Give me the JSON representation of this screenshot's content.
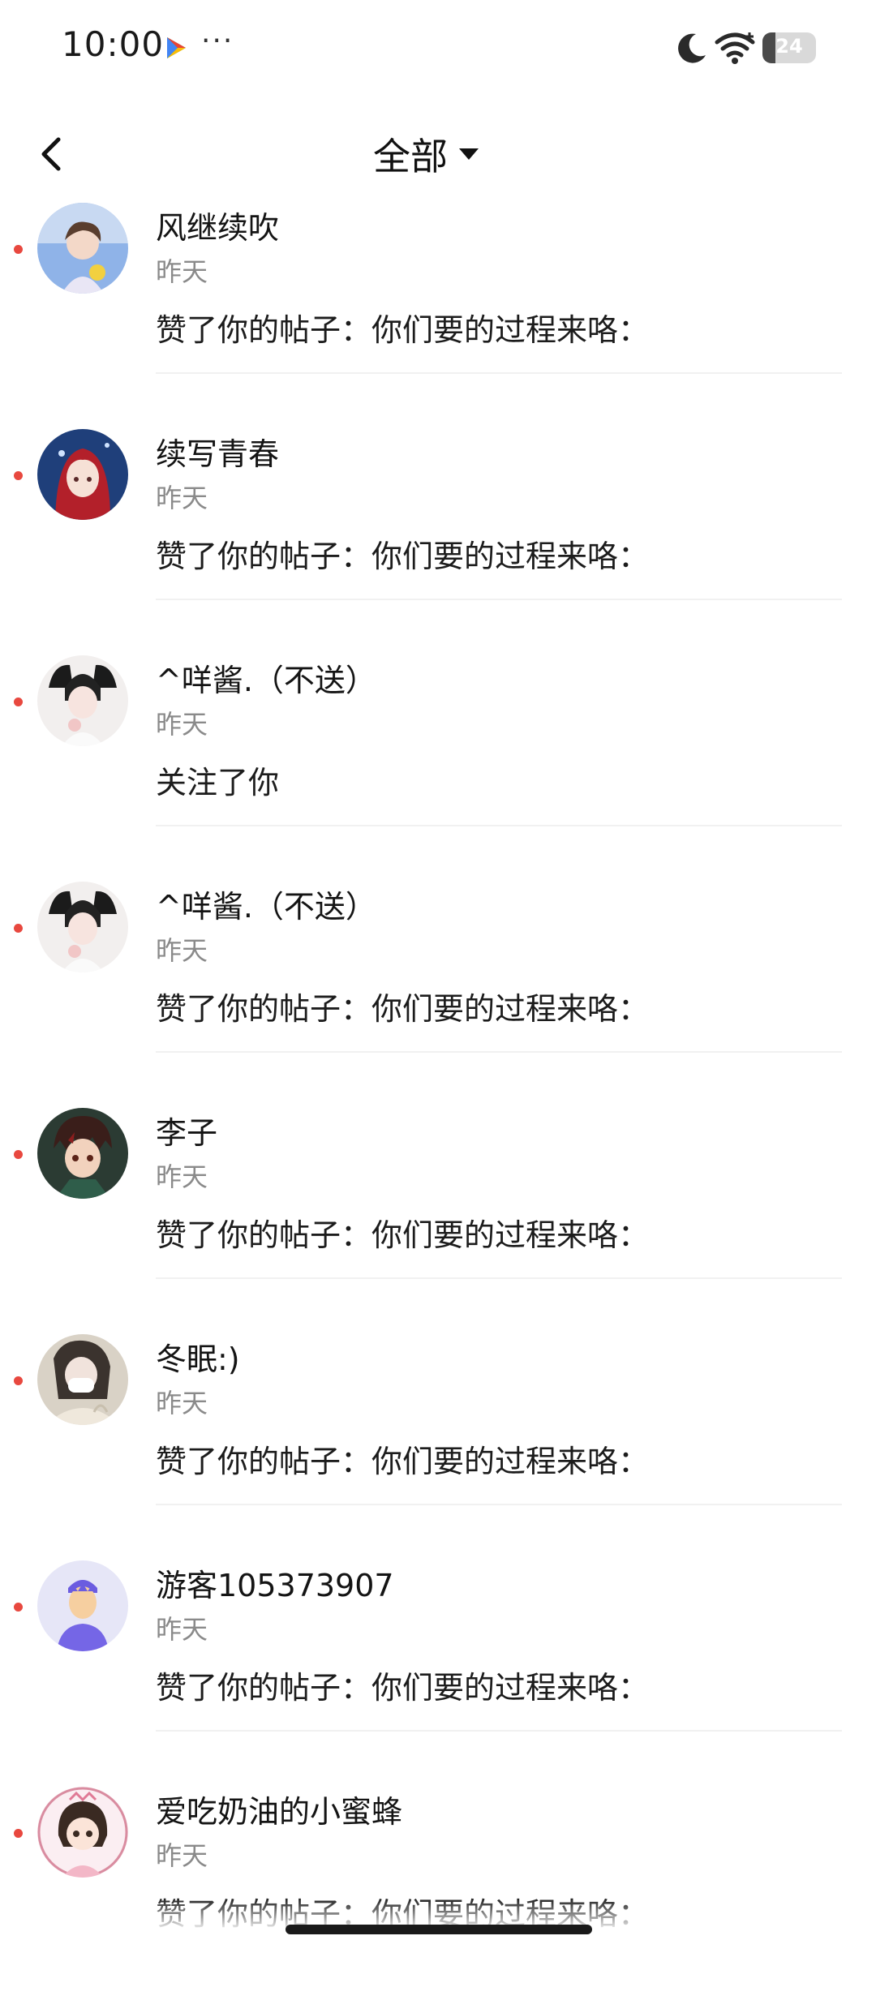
{
  "status_bar": {
    "time": "10:00",
    "more": "···",
    "battery_level": 24,
    "battery_text": "24"
  },
  "header": {
    "filter_label": "全部"
  },
  "notifications": [
    {
      "name": "风继续吹",
      "time": "昨天",
      "message": "赞了你的帖子：你们要的过程来咯："
    },
    {
      "name": "续写青春",
      "time": "昨天",
      "message": "赞了你的帖子：你们要的过程来咯："
    },
    {
      "name": "^咩酱.（不送）",
      "time": "昨天",
      "message": "关注了你"
    },
    {
      "name": "^咩酱.（不送）",
      "time": "昨天",
      "message": "赞了你的帖子：你们要的过程来咯："
    },
    {
      "name": "李子",
      "time": "昨天",
      "message": "赞了你的帖子：你们要的过程来咯："
    },
    {
      "name": "冬眠:)",
      "time": "昨天",
      "message": "赞了你的帖子：你们要的过程来咯："
    },
    {
      "name": "游客105373907",
      "time": "昨天",
      "message": "赞了你的帖子：你们要的过程来咯："
    },
    {
      "name": "爱吃奶油的小蜜蜂",
      "time": "昨天",
      "message": "赞了你的帖子：你们要的过程来咯："
    }
  ],
  "colors": {
    "unread_dot": "#e8483f",
    "secondary_text": "#8a8a8a",
    "primary_text": "#141414"
  },
  "icons": {
    "back": "chevron-left-icon",
    "dropdown": "triangle-down-icon",
    "moon": "moon-icon",
    "wifi": "wifi-icon",
    "play": "play-store-icon"
  }
}
